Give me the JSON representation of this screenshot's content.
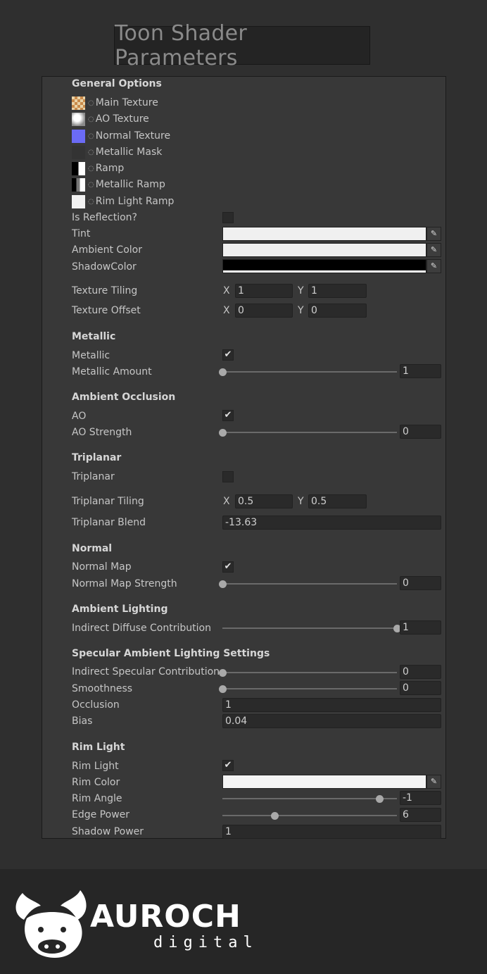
{
  "title": "Toon Shader Parameters",
  "colors": {
    "tint": "#f0f0f0",
    "ambient": "#f0f0f0",
    "shadow": "#000000",
    "rim": "#f4f4f4",
    "normal_tex": "#6b6bf5"
  },
  "general": {
    "header": "General Options",
    "textures": [
      "Main Texture",
      "AO Texture",
      "Normal Texture",
      "Metallic Mask",
      "Ramp",
      "Metallic Ramp",
      "Rim Light Ramp"
    ],
    "is_reflection_label": "Is Reflection?",
    "tint_label": "Tint",
    "ambient_label": "Ambient Color",
    "shadow_label": "ShadowColor",
    "tiling_label": "Texture Tiling",
    "tiling_x": "1",
    "tiling_y": "1",
    "offset_label": "Texture Offset",
    "offset_x": "0",
    "offset_y": "0",
    "x_axis": "X",
    "y_axis": "Y"
  },
  "metallic": {
    "header": "Metallic",
    "toggle_label": "Metallic",
    "amount_label": "Metallic Amount",
    "amount_value": "1",
    "amount_fraction": 0
  },
  "ao": {
    "header": "Ambient Occlusion",
    "toggle_label": "AO",
    "strength_label": "AO Strength",
    "strength_value": "0",
    "strength_fraction": 0
  },
  "triplanar": {
    "header": "Triplanar",
    "toggle_label": "Triplanar",
    "tiling_label": "Triplanar Tiling",
    "tiling_x": "0.5",
    "tiling_y": "0.5",
    "blend_label": "Triplanar Blend",
    "blend_value": "-13.63"
  },
  "normal": {
    "header": "Normal",
    "map_label": "Normal Map",
    "strength_label": "Normal Map Strength",
    "strength_value": "0",
    "strength_fraction": 0
  },
  "ambient_lighting": {
    "header": "Ambient Lighting",
    "diffuse_label": "Indirect Diffuse Contribution",
    "diffuse_value": "1",
    "diffuse_fraction": 1
  },
  "specular": {
    "header": "Specular Ambient Lighting Settings",
    "contrib_label": "Indirect Specular Contribution",
    "contrib_value": "0",
    "contrib_fraction": 0,
    "smooth_label": "Smoothness",
    "smooth_value": "0",
    "smooth_fraction": 0,
    "occlusion_label": "Occlusion",
    "occlusion_value": "1",
    "bias_label": "Bias",
    "bias_value": "0.04"
  },
  "rim": {
    "header": "Rim Light",
    "toggle_label": "Rim Light",
    "color_label": "Rim Color",
    "angle_label": "Rim Angle",
    "angle_value": "-1",
    "angle_fraction": 0.9,
    "edge_label": "Edge Power",
    "edge_value": "6",
    "edge_fraction": 0.3,
    "shadow_label": "Shadow Power",
    "shadow_value": "1"
  },
  "footer": {
    "brand": "AUROCH",
    "sub": "digital"
  },
  "check_mark": "✔",
  "eyedropper": "✎"
}
